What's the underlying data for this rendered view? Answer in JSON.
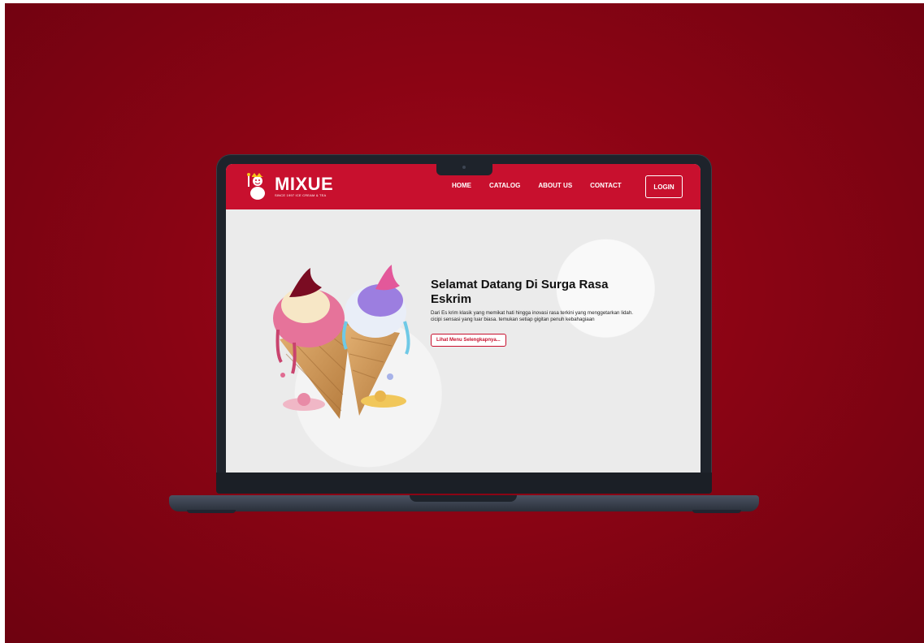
{
  "brand": {
    "name": "MIXUE",
    "tagline": "SINCE 1997 ICE CREAM & TEA",
    "color": "#c8102e"
  },
  "nav": {
    "items": [
      "HOME",
      "CATALOG",
      "ABOUT US",
      "CONTACT"
    ],
    "login_label": "LOGIN"
  },
  "hero": {
    "title_line1": "Selamat Datang Di Surga Rasa",
    "title_line2": "Eskrim",
    "description_line1": "Dari Es krim klasik yang memikat hati hingga inovasi rasa terkini yang menggetarkan lidah.",
    "description_line2": "cicipi sensasi yang luar biasa. temukan setiap gigitan  penuh kebahagiaan",
    "button_label": "Lihat Menu Selengkapnya..."
  },
  "icons": {
    "logo": "snowman-mascot-icon",
    "hero_image": "ice-cream-cones-illustration"
  }
}
